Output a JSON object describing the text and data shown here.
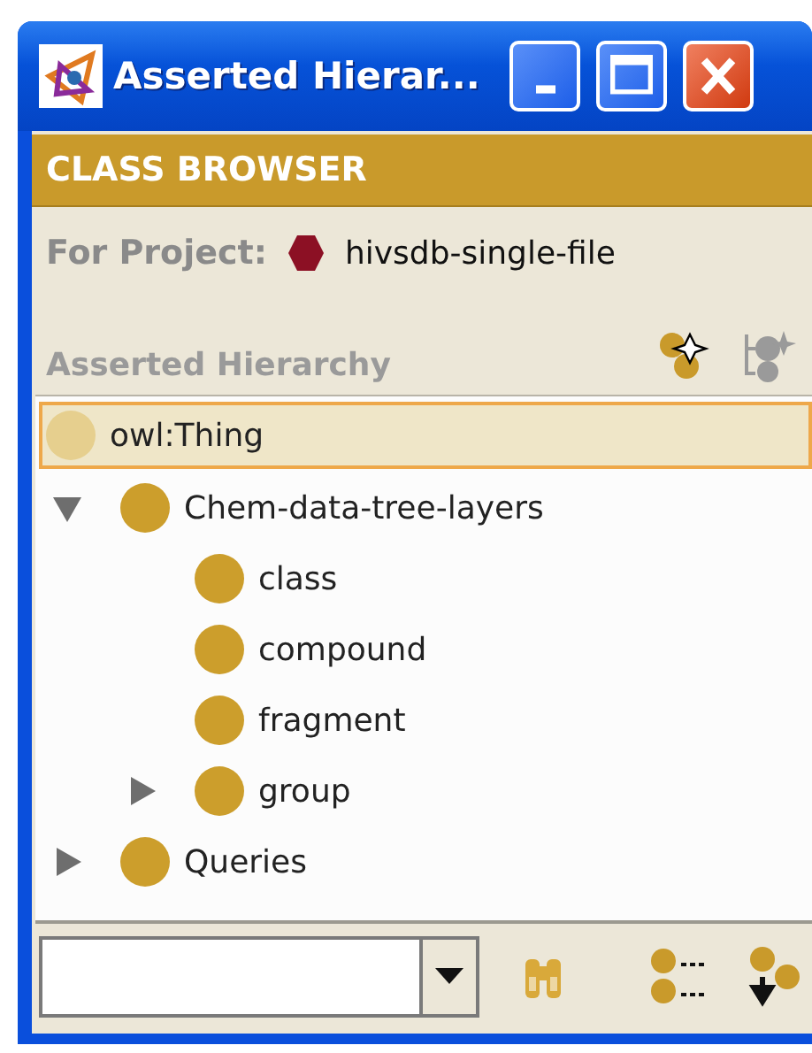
{
  "window": {
    "title": "Asserted Hierar...",
    "controls": [
      {
        "kind": "minimize"
      },
      {
        "kind": "maximize"
      },
      {
        "kind": "close"
      }
    ]
  },
  "panel": {
    "title": "CLASS BROWSER",
    "project_label": "For Project:",
    "project_name": "hivsdb-single-file"
  },
  "hierarchy": {
    "title": "Asserted Hierarchy",
    "tools": [
      {
        "kind": "create-subclass",
        "disabled": false
      },
      {
        "kind": "delete-class",
        "disabled": true
      }
    ],
    "tree": [
      {
        "label": "owl:Thing",
        "kind": "root",
        "selected": true,
        "color": "#e6cf8e",
        "children": [
          {
            "label": "Chem-data-tree-layers",
            "kind": "branch",
            "expanded": true,
            "selected": false,
            "color": "#cc9e2c",
            "children": [
              {
                "label": "class",
                "kind": "leaf",
                "selected": false,
                "color": "#cc9e2c"
              },
              {
                "label": "compound",
                "kind": "leaf",
                "selected": false,
                "color": "#cc9e2c"
              },
              {
                "label": "fragment",
                "kind": "leaf",
                "selected": false,
                "color": "#cc9e2c"
              },
              {
                "label": "group",
                "kind": "branch",
                "expanded": false,
                "selected": false,
                "color": "#cc9e2c"
              }
            ]
          },
          {
            "label": "Queries",
            "kind": "branch",
            "expanded": false,
            "selected": false,
            "color": "#cc9e2c"
          }
        ]
      }
    ]
  },
  "footer": {
    "tools": [
      {
        "kind": "find"
      },
      {
        "kind": "list"
      },
      {
        "kind": "move-down"
      }
    ]
  }
}
